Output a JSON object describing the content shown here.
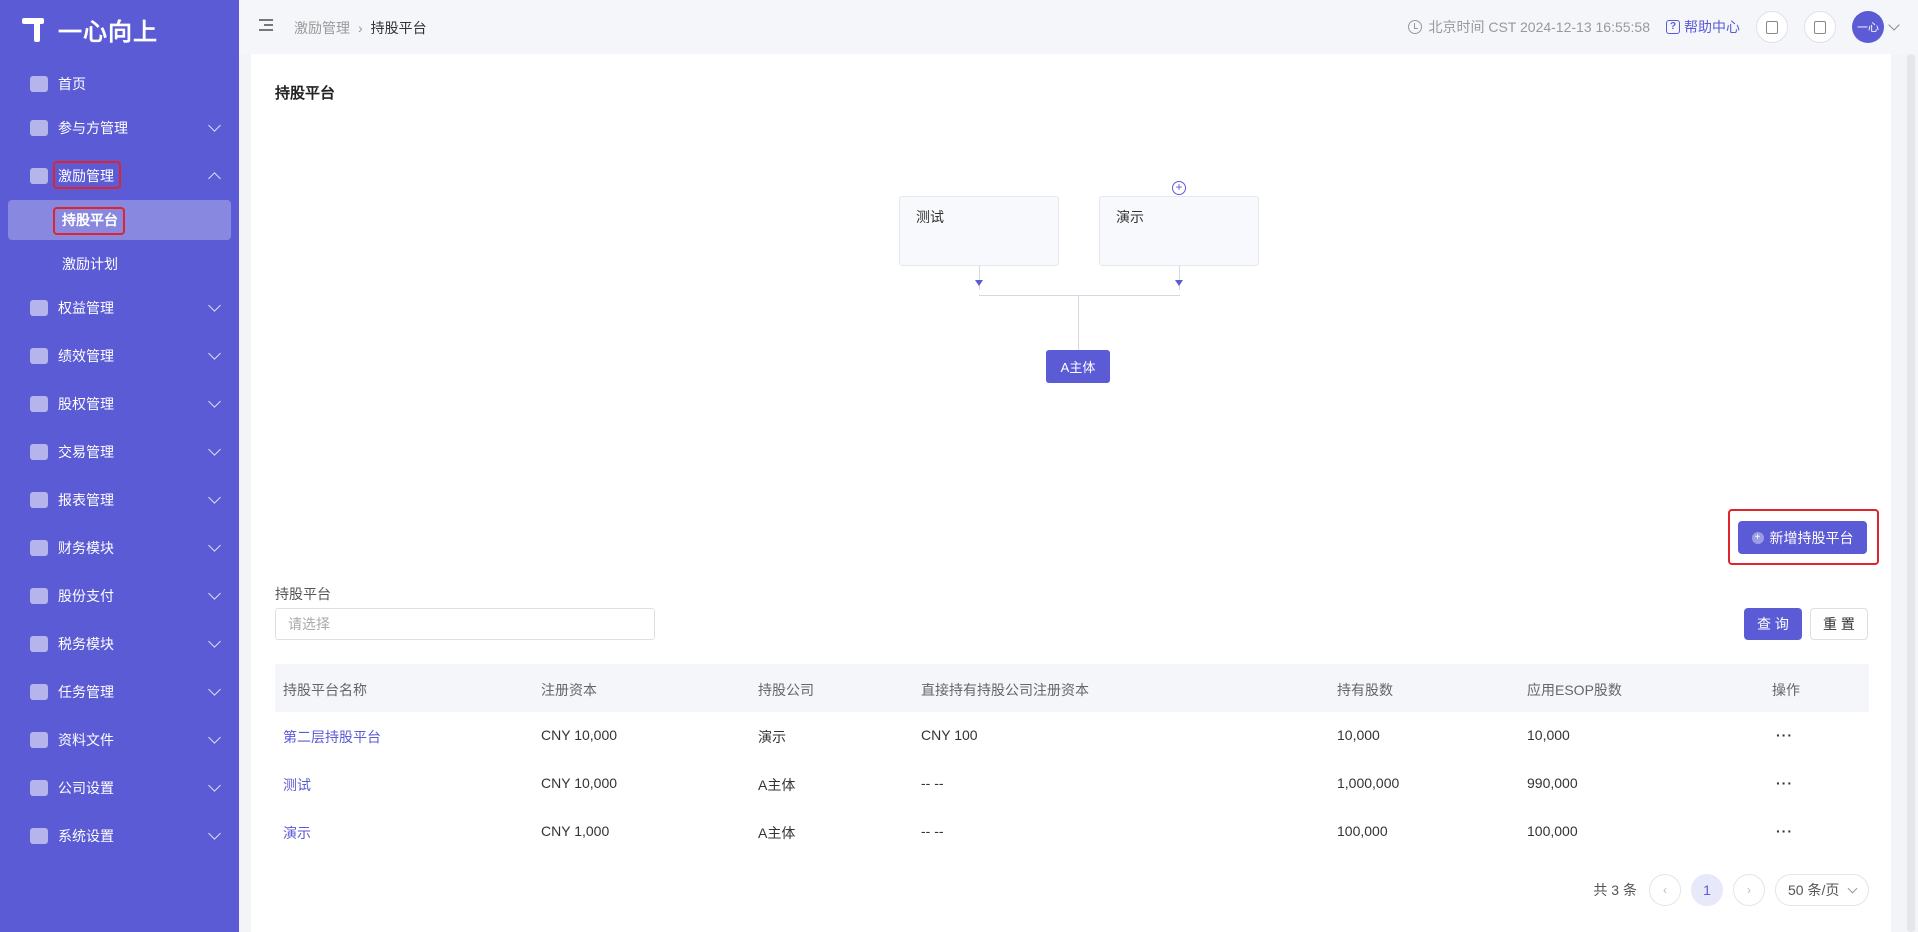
{
  "app": {
    "name": "一心向上"
  },
  "sidebar": {
    "items": [
      {
        "label": "首页",
        "icon": "home-icon",
        "expandable": false
      },
      {
        "label": "参与方管理",
        "icon": "participants-icon",
        "expandable": true
      },
      {
        "label": "激励管理",
        "icon": "incentive-icon",
        "expandable": true,
        "expanded": true,
        "children": [
          {
            "label": "持股平台",
            "active": true
          },
          {
            "label": "激励计划"
          }
        ]
      },
      {
        "label": "权益管理",
        "icon": "equity-icon",
        "expandable": true
      },
      {
        "label": "绩效管理",
        "icon": "performance-icon",
        "expandable": true
      },
      {
        "label": "股权管理",
        "icon": "shares-icon",
        "expandable": true
      },
      {
        "label": "交易管理",
        "icon": "trade-icon",
        "expandable": true
      },
      {
        "label": "报表管理",
        "icon": "report-icon",
        "expandable": true
      },
      {
        "label": "财务模块",
        "icon": "finance-icon",
        "expandable": true
      },
      {
        "label": "股份支付",
        "icon": "share-payment-icon",
        "expandable": true
      },
      {
        "label": "税务模块",
        "icon": "tax-icon",
        "expandable": true
      },
      {
        "label": "任务管理",
        "icon": "task-icon",
        "expandable": true
      },
      {
        "label": "资料文件",
        "icon": "files-icon",
        "expandable": true
      },
      {
        "label": "公司设置",
        "icon": "company-icon",
        "expandable": true
      },
      {
        "label": "系统设置",
        "icon": "system-icon",
        "expandable": true
      }
    ]
  },
  "header": {
    "breadcrumb": [
      "激励管理",
      "持股平台"
    ],
    "time": "北京时间 CST 2024-12-13 16:55:58",
    "help": "帮助中心",
    "avatar": "一心"
  },
  "page": {
    "title": "持股平台"
  },
  "diagram": {
    "nodes": [
      "测试",
      "演示"
    ],
    "entity": "A主体"
  },
  "actions": {
    "add_label": "新增持股平台"
  },
  "filter": {
    "label": "持股平台",
    "placeholder": "请选择",
    "query_label": "查 询",
    "reset_label": "重 置"
  },
  "table": {
    "columns": [
      "持股平台名称",
      "注册资本",
      "持股公司",
      "直接持有持股公司注册资本",
      "持有股数",
      "应用ESOP股数",
      "操作"
    ],
    "rows": [
      [
        "第二层持股平台",
        "CNY 10,000",
        "演示",
        "CNY 100",
        "10,000",
        "10,000",
        "···"
      ],
      [
        "测试",
        "CNY 10,000",
        "A主体",
        "-- --",
        "1,000,000",
        "990,000",
        "···"
      ],
      [
        "演示",
        "CNY 1,000",
        "A主体",
        "-- --",
        "100,000",
        "100,000",
        "···"
      ]
    ]
  },
  "pagination": {
    "total": "共 3 条",
    "prev": "‹",
    "current": "1",
    "next": "›",
    "page_size": "50 条/页"
  },
  "colors": {
    "primary": "#5b5bd6",
    "highlight": "#e0242e"
  }
}
